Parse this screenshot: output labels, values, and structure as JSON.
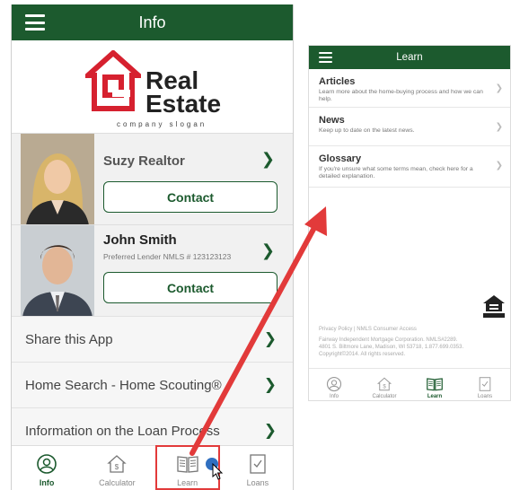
{
  "left_phone": {
    "header": {
      "title": "Info"
    },
    "logo": {
      "line1": "Real",
      "line2": "Estate",
      "slogan": "company slogan"
    },
    "agents": [
      {
        "name": "Suzy Realtor",
        "subtitle": "",
        "contact_label": "Contact"
      },
      {
        "name": "John Smith",
        "subtitle": "Preferred Lender  NMLS # 123123123",
        "contact_label": "Contact"
      }
    ],
    "menu": [
      {
        "label": "Share this App"
      },
      {
        "label": "Home Search - Home Scouting®"
      },
      {
        "label": "Information on the Loan Process"
      }
    ],
    "tabs": [
      {
        "label": "Info",
        "icon": "info-icon"
      },
      {
        "label": "Calculator",
        "icon": "calculator-icon"
      },
      {
        "label": "Learn",
        "icon": "book-icon"
      },
      {
        "label": "Loans",
        "icon": "checklist-icon"
      }
    ]
  },
  "right_phone": {
    "header": {
      "title": "Learn"
    },
    "items": [
      {
        "title": "Articles",
        "desc": "Learn more about the home-buying process and how we can help."
      },
      {
        "title": "News",
        "desc": "Keep up to date on the latest news."
      },
      {
        "title": "Glossary",
        "desc": "If you're unsure what some terms mean, check here for a detailed explanation."
      }
    ],
    "footer": {
      "links": "Privacy Policy   |   NMLS Consumer Access",
      "line1": "Fairway Independent Mortgage Corporation. NMLS#2289.",
      "line2": "4801 S. Biltmore Lane, Madison, WI 53718, 1.877.699.0353.",
      "line3": "Copyright©2014. All rights reserved.",
      "lender_badge": "EQUAL HOUSING LENDER"
    },
    "tabs": [
      {
        "label": "Info",
        "icon": "info-icon"
      },
      {
        "label": "Calculator",
        "icon": "calculator-icon"
      },
      {
        "label": "Learn",
        "icon": "book-icon"
      },
      {
        "label": "Loans",
        "icon": "checklist-icon"
      }
    ]
  },
  "colors": {
    "brand_green": "#1c5a2e",
    "logo_red": "#d6212f",
    "annotation_red": "#e23a3a",
    "cursor_blue": "#2f6fc0"
  }
}
